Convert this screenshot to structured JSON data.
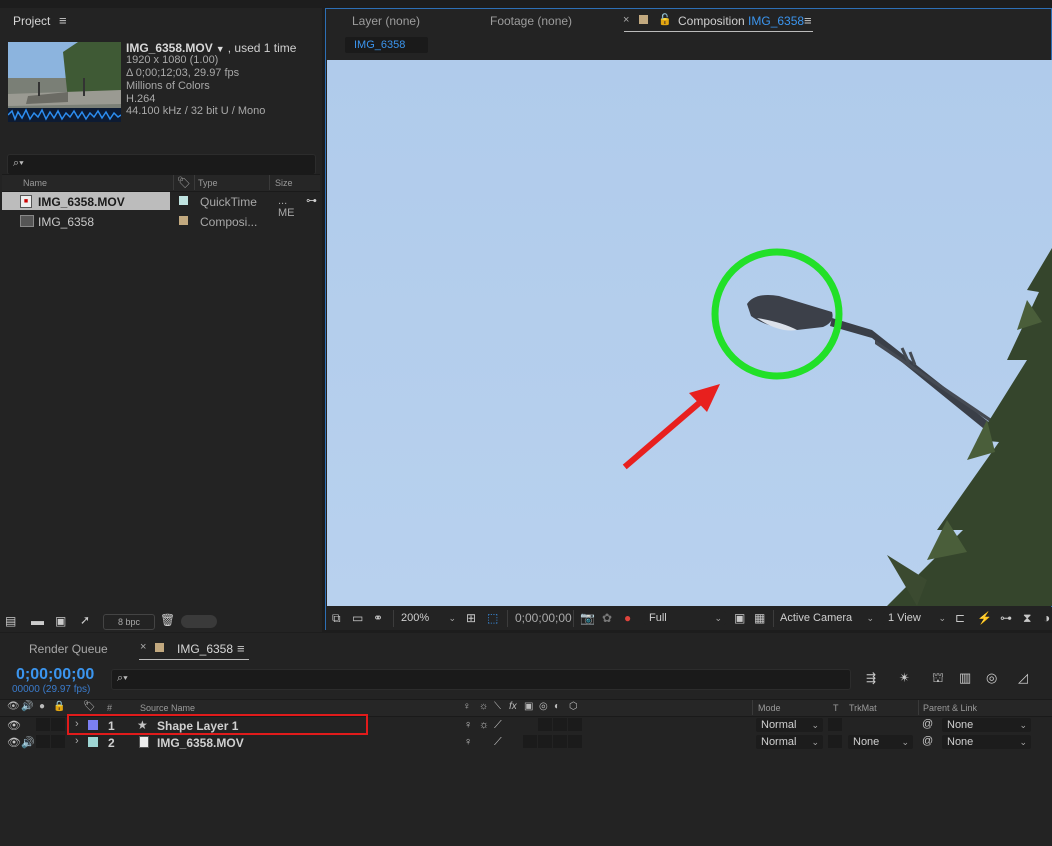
{
  "project": {
    "tab_label": "Project",
    "menu_icon": "hamburger-icon",
    "selected": {
      "name": "IMG_6358.MOV",
      "used": ", used 1 time",
      "resolution": "1920 x 1080 (1.00)",
      "duration": "Δ 0;00;12;03, 29.97 fps",
      "colors": "Millions of Colors",
      "codec": "H.264",
      "audio": "44.100 kHz / 32 bit U / Mono"
    },
    "columns": {
      "name": "Name",
      "type": "Type",
      "size": "Size"
    },
    "items": [
      {
        "name": "IMG_6358.MOV",
        "type": "QuickTime",
        "size": "... ME",
        "swatch": "#bfe3e0",
        "selected": true
      },
      {
        "name": "IMG_6358",
        "type": "Composi...",
        "size": "",
        "swatch": "#c2a97f",
        "selected": false
      }
    ],
    "bpc_label": "8 bpc"
  },
  "viewer": {
    "tabs": {
      "layer": "Layer (none)",
      "footage": "Footage (none)",
      "comp_prefix": "Composition",
      "comp_name": "IMG_6358"
    },
    "sub_tab": "IMG_6358",
    "zoom": "200%",
    "timecode": "0;00;00;00",
    "resolution": "Full",
    "camera": "Active Camera",
    "views": "1 View",
    "annotation_colors": {
      "circle": "#22e028",
      "arrow": "#e8201e"
    }
  },
  "timeline": {
    "render_queue_tab": "Render Queue",
    "comp_tab": "IMG_6358",
    "timecode": "0;00;00;00",
    "frame_info": "00000 (29.97 fps)",
    "headers": {
      "hash": "#",
      "source_name": "Source Name",
      "mode": "Mode",
      "t": "T",
      "trkmat": "TrkMat",
      "parent": "Parent & Link"
    },
    "layers": [
      {
        "num": "1",
        "name": "Shape Layer 1",
        "label_color": "#7b7ff2",
        "mode": "Normal",
        "trkmat": "",
        "parent": "None",
        "highlighted": true
      },
      {
        "num": "2",
        "name": "IMG_6358.MOV",
        "label_color": "#9fd6d4",
        "mode": "Normal",
        "trkmat": "None",
        "parent": "None",
        "highlighted": false
      }
    ]
  }
}
